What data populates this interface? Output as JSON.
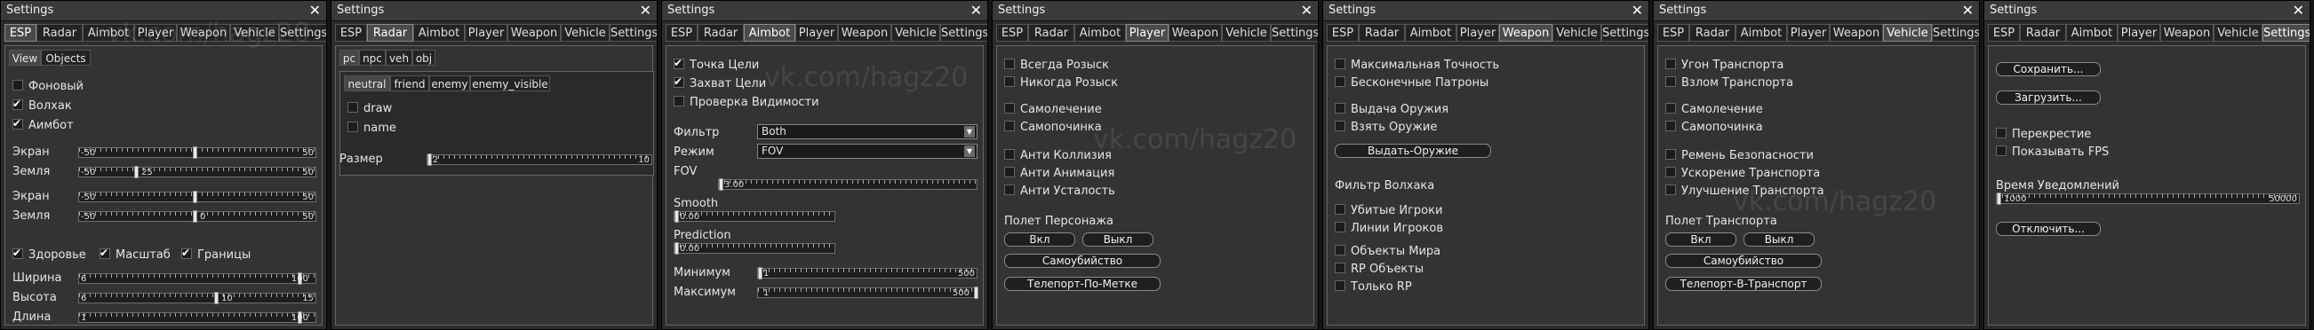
{
  "window_title": "Settings",
  "close_glyph": "✕",
  "tabs": [
    "ESP",
    "Radar",
    "Aimbot",
    "Player",
    "Weapon",
    "Vehicle",
    "Settings"
  ],
  "watermark_text": "vk.com/hagz20",
  "esp": {
    "subtabs": [
      "View",
      "Objects"
    ],
    "checks": [
      {
        "label": "Фоновый",
        "checked": false
      },
      {
        "label": "Волхак",
        "checked": true
      },
      {
        "label": "Аимбот",
        "checked": true
      }
    ],
    "sliders": [
      {
        "label": "Экран",
        "min": "-50",
        "max": "50",
        "value": "0"
      },
      {
        "label": "Земля",
        "min": "-50",
        "max": "50",
        "value": "25"
      },
      {
        "label": "Экран",
        "min": "-50",
        "max": "50",
        "value": "0"
      },
      {
        "label": "Земля",
        "min": "-50",
        "max": "50",
        "value": "0"
      }
    ],
    "inline_checks": [
      {
        "label": "Здоровье",
        "checked": true
      },
      {
        "label": "Масштаб",
        "checked": true
      },
      {
        "label": "Границы",
        "checked": true
      }
    ],
    "size_sliders": [
      {
        "label": "Ширина",
        "min": "6",
        "max": "100",
        "value": "100"
      },
      {
        "label": "Высота",
        "min": "6",
        "max": "15",
        "value": "10"
      },
      {
        "label": "Длина",
        "min": "1",
        "max": "100",
        "value": "100"
      }
    ]
  },
  "radar": {
    "subtabs": [
      "pc",
      "npc",
      "veh",
      "obj"
    ],
    "filter_tabs": [
      "neutral",
      "friend",
      "enemy",
      "enemy_visible"
    ],
    "checks": [
      {
        "label": "draw",
        "checked": false
      },
      {
        "label": "name",
        "checked": false
      }
    ],
    "size": {
      "label": "Размер",
      "min": "2",
      "max": "10",
      "value": "2"
    }
  },
  "aimbot": {
    "checks": [
      {
        "label": "Точка Цели",
        "checked": true
      },
      {
        "label": "Захват Цели",
        "checked": true
      },
      {
        "label": "Проверка Видимости",
        "checked": false
      }
    ],
    "filter": {
      "label": "Фильтр",
      "value": "Both"
    },
    "mode": {
      "label": "Режим",
      "value": "FOV"
    },
    "fov": {
      "label": "FOV",
      "value": "3.00"
    },
    "smooth": {
      "label": "Smooth",
      "value": "0.00"
    },
    "prediction": {
      "label": "Prediction",
      "value": "0.00"
    },
    "min": {
      "label": "Минимум",
      "min": "1",
      "max": "500",
      "value": "1"
    },
    "max": {
      "label": "Максимум",
      "min": "1",
      "max": "500",
      "value": "500"
    }
  },
  "player": {
    "checks": [
      {
        "label": "Всегда Розыск",
        "checked": false
      },
      {
        "label": "Никогда Розыск",
        "checked": false
      },
      {
        "label": "Самолечение",
        "checked": false
      },
      {
        "label": "Самопочинка",
        "checked": false
      },
      {
        "label": "Анти Коллизия",
        "checked": false
      },
      {
        "label": "Анти Анимация",
        "checked": false
      },
      {
        "label": "Анти Усталость",
        "checked": false
      }
    ],
    "section": "Полет Персонажа",
    "btn_on": "Вкл",
    "btn_off": "Выкл",
    "btn_suicide": "Самоубийство",
    "btn_teleport": "Телепорт-По-Метке"
  },
  "weapon": {
    "checks": [
      {
        "label": "Максимальная Точность",
        "checked": false
      },
      {
        "label": "Бесконечные Патроны",
        "checked": false
      },
      {
        "label": "Выдача Оружия",
        "checked": false
      },
      {
        "label": "Взять Оружие",
        "checked": false
      }
    ],
    "btn_give": "Выдать-Оружие",
    "section": "Фильтр Волхака",
    "filter_checks": [
      {
        "label": "Убитые Игроки",
        "checked": false
      },
      {
        "label": "Линии Игроков",
        "checked": false
      },
      {
        "label": "Объекты Мира",
        "checked": false
      },
      {
        "label": "RP Объекты",
        "checked": false
      },
      {
        "label": "Только RP",
        "checked": false
      }
    ]
  },
  "vehicle": {
    "checks": [
      {
        "label": "Угон Транспорта",
        "checked": false
      },
      {
        "label": "Взлом Транспорта",
        "checked": false
      },
      {
        "label": "Самолечение",
        "checked": false
      },
      {
        "label": "Самопочинка",
        "checked": false
      },
      {
        "label": "Ремень Безопасности",
        "checked": false
      },
      {
        "label": "Ускорение Транспорта",
        "checked": false
      },
      {
        "label": "Улучшение Транспорта",
        "checked": false
      }
    ],
    "section": "Полет Транспорта",
    "btn_on": "Вкл",
    "btn_off": "Выкл",
    "btn_suicide": "Самоубийство",
    "btn_teleport": "Телепорт-В-Транспорт"
  },
  "settings": {
    "btn_save": "Сохранить...",
    "btn_load": "Загрузить...",
    "checks": [
      {
        "label": "Перекрестие",
        "checked": false
      },
      {
        "label": "Показывать FPS",
        "checked": false
      }
    ],
    "notify": {
      "label": "Время Уведомлений",
      "min": "1000",
      "max": "50000",
      "value": "1000"
    },
    "btn_disable": "Отключить..."
  }
}
